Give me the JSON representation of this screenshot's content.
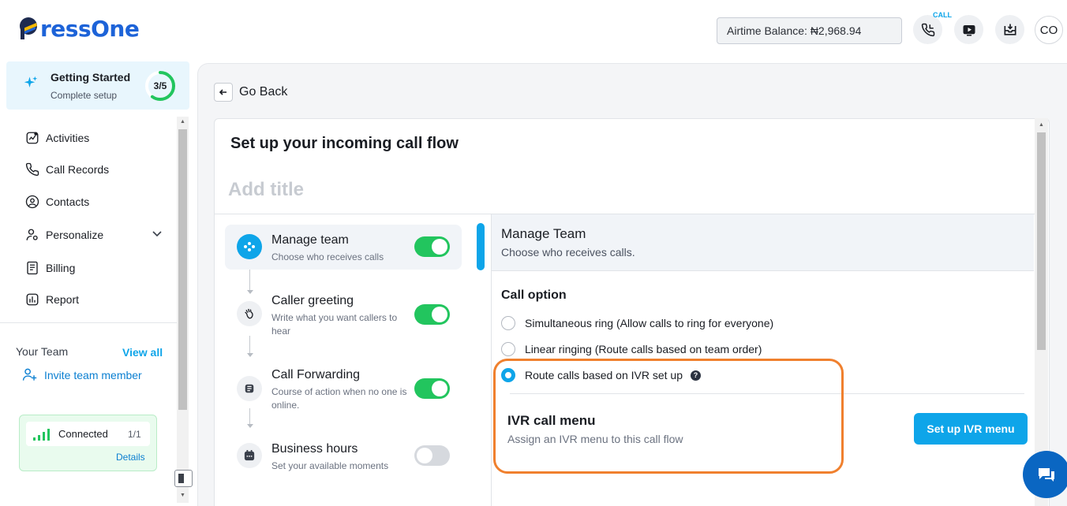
{
  "brand": {
    "logo_text": "ressOne",
    "accent": "#0ea5e9",
    "brand_blue": "#1d63d8",
    "success": "#22c55e",
    "highlight": "#f0802e"
  },
  "header": {
    "airtime_label": "Airtime Balance: ₦2,968.94",
    "call_tag": "CALL",
    "avatar_initials": "CO",
    "icons": [
      "phone-icon",
      "video-icon",
      "inbox-download-icon"
    ]
  },
  "sidebar": {
    "getting_started": {
      "title": "Getting Started",
      "subtitle": "Complete setup",
      "progress_text": "3/5",
      "progress_fraction": 0.6
    },
    "items": [
      {
        "label": "Activities",
        "icon": "activity-icon"
      },
      {
        "label": "Call Records",
        "icon": "phone-icon"
      },
      {
        "label": "Contacts",
        "icon": "contact-icon"
      },
      {
        "label": "Personalize",
        "icon": "user-gear-icon",
        "has_submenu": true
      },
      {
        "label": "Billing",
        "icon": "receipt-icon"
      },
      {
        "label": "Report",
        "icon": "chart-icon"
      }
    ],
    "team": {
      "label": "Your Team",
      "view_all": "View all",
      "invite": "Invite team member"
    },
    "connection": {
      "label": "Connected",
      "count": "1/1",
      "details": "Details"
    }
  },
  "main": {
    "go_back": "Go Back",
    "title": "Set up your incoming call flow",
    "title_placeholder": "Add title",
    "steps": [
      {
        "title": "Manage team",
        "desc": "Choose who receives calls",
        "enabled": true,
        "active": true,
        "icon": "team-icon"
      },
      {
        "title": "Caller greeting",
        "desc": "Write what you want callers to hear",
        "enabled": true,
        "active": false,
        "icon": "wave-hand-icon"
      },
      {
        "title": "Call Forwarding",
        "desc": "Course of action when no one is online.",
        "enabled": true,
        "active": false,
        "icon": "forward-icon"
      },
      {
        "title": "Business hours",
        "desc": "Set your available moments",
        "enabled": false,
        "active": false,
        "icon": "calendar-icon"
      }
    ],
    "section": {
      "title": "Manage Team",
      "subtitle": "Choose who receives calls.",
      "call_option_label": "Call option",
      "options": [
        {
          "label": "Simultaneous ring (Allow calls to ring for everyone)",
          "checked": false
        },
        {
          "label": "Linear ringing (Route calls based on team order)",
          "checked": false
        },
        {
          "label": "Route calls based on IVR set up",
          "checked": true
        }
      ],
      "ivr": {
        "title": "IVR call menu",
        "subtitle": "Assign an IVR menu to this call flow",
        "button": "Set up IVR menu"
      }
    }
  }
}
